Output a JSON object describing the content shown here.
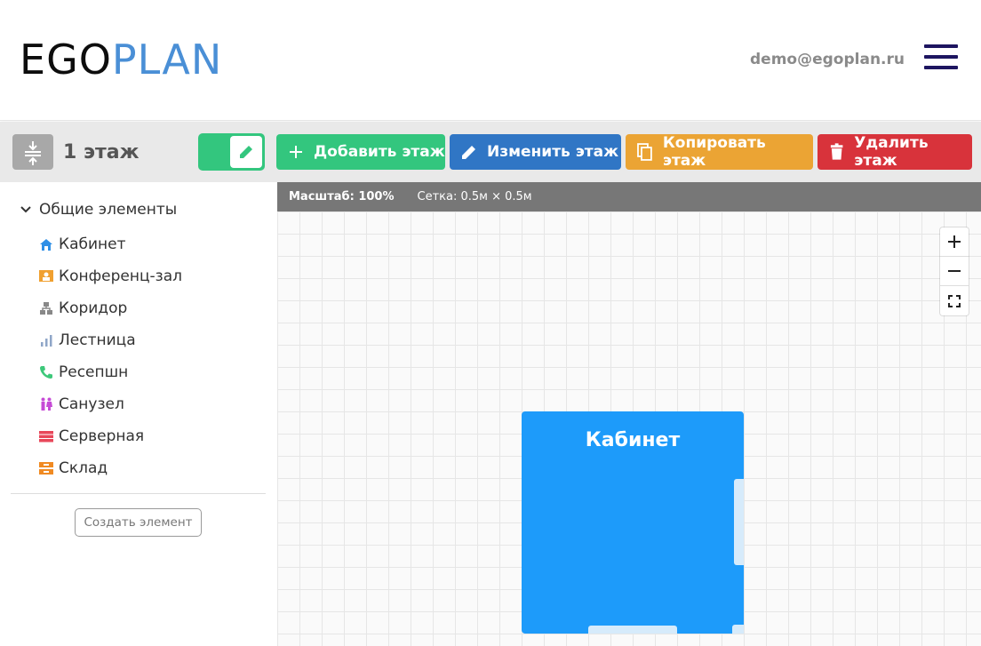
{
  "header": {
    "logo_part1": "EGO",
    "logo_part2": "PLAN",
    "user_email": "demo@egoplan.ru",
    "menu_icon": "hamburger-menu-icon"
  },
  "toolbar": {
    "floor_title": "1 этаж",
    "add_floor": "Добавить этаж",
    "edit_floor": "Изменить этаж",
    "copy_floor": "Копировать этаж",
    "delete_floor": "Удалить этаж"
  },
  "sidebar": {
    "group_title": "Общие элементы",
    "items": [
      {
        "label": "Кабинет",
        "icon": "house-icon",
        "color": "#2e8fe6"
      },
      {
        "label": "Конференц-зал",
        "icon": "presentation-icon",
        "color": "#f0a030"
      },
      {
        "label": "Коридор",
        "icon": "sitemap-icon",
        "color": "#888888"
      },
      {
        "label": "Лестница",
        "icon": "bar-chart-icon",
        "color": "#8fa6c8"
      },
      {
        "label": "Ресепшн",
        "icon": "phone-icon",
        "color": "#3dc87a"
      },
      {
        "label": "Санузел",
        "icon": "restroom-icon",
        "color": "#c64bd6"
      },
      {
        "label": "Серверная",
        "icon": "server-icon",
        "color": "#e8475a"
      },
      {
        "label": "Склад",
        "icon": "inbox-icon",
        "color": "#f08a22"
      }
    ],
    "create_button": "Создать элемент"
  },
  "canvas": {
    "scale_text": "Масштаб: 100%",
    "grid_text": "Сетка: 0.5м × 0.5м",
    "room_label": "Кабинет",
    "room_color": "#1d9bfa"
  },
  "colors": {
    "green": "#33c67e",
    "blue": "#3076c5",
    "orange": "#eba434",
    "red": "#d8333b"
  }
}
